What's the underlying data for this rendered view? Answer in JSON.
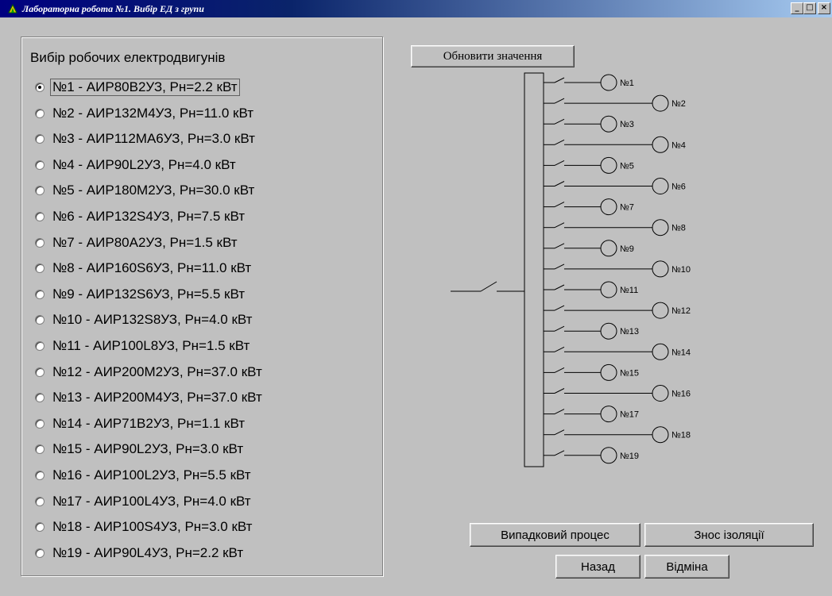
{
  "window": {
    "title": "Лабораторна робота №1. Вибір ЕД з групи",
    "app_icon": "app-icon",
    "buttons": [
      "minimize",
      "maximize",
      "close"
    ]
  },
  "group": {
    "title": "Вибір робочих електродвигунів",
    "selected_index": 0,
    "items": [
      {
        "label": "№1 - АИР80В2УЗ, Рн=2.2 кВт"
      },
      {
        "label": "№2 - АИР132М4УЗ, Рн=11.0 кВт"
      },
      {
        "label": "№3 - АИР112МА6УЗ, Рн=3.0 кВт"
      },
      {
        "label": "№4 - АИР90L2УЗ, Рн=4.0 кВт"
      },
      {
        "label": "№5 - АИР180М2УЗ, Рн=30.0 кВт"
      },
      {
        "label": "№6 - АИР132S4УЗ, Рн=7.5 кВт"
      },
      {
        "label": "№7 - АИР80А2УЗ, Рн=1.5 кВт"
      },
      {
        "label": "№8 - АИР160S6УЗ, Рн=11.0 кВт"
      },
      {
        "label": "№9 - АИР132S6УЗ, Рн=5.5 кВт"
      },
      {
        "label": "№10 - АИР132S8УЗ, Рн=4.0 кВт"
      },
      {
        "label": "№11 - АИР100L8УЗ, Рн=1.5 кВт"
      },
      {
        "label": "№12 - АИР200М2УЗ, Рн=37.0 кВт"
      },
      {
        "label": "№13 - АИР200М4УЗ, Рн=37.0 кВт"
      },
      {
        "label": "№14 - АИР71В2УЗ, Рн=1.1 кВт"
      },
      {
        "label": "№15 - АИР90L2УЗ, Рн=3.0 кВт"
      },
      {
        "label": "№16 - АИР100L2УЗ, Рн=5.5 кВт"
      },
      {
        "label": "№17 - АИР100L4УЗ, Рн=4.0 кВт"
      },
      {
        "label": "№18 - АИР100S4УЗ, Рн=3.0 кВт"
      },
      {
        "label": "№19 - АИР90L4УЗ, Рн=2.2 кВт"
      }
    ]
  },
  "buttons": {
    "refresh": "Обновити значення",
    "random_process": "Випадковий процес",
    "insulation_wear": "Знос ізоляції",
    "back": "Назад",
    "cancel": "Відміна"
  },
  "schematic": {
    "motors": [
      "№1",
      "№2",
      "№3",
      "№4",
      "№5",
      "№6",
      "№7",
      "№8",
      "№9",
      "№10",
      "№11",
      "№12",
      "№13",
      "№14",
      "№15",
      "№16",
      "№17",
      "№18",
      "№19"
    ]
  }
}
